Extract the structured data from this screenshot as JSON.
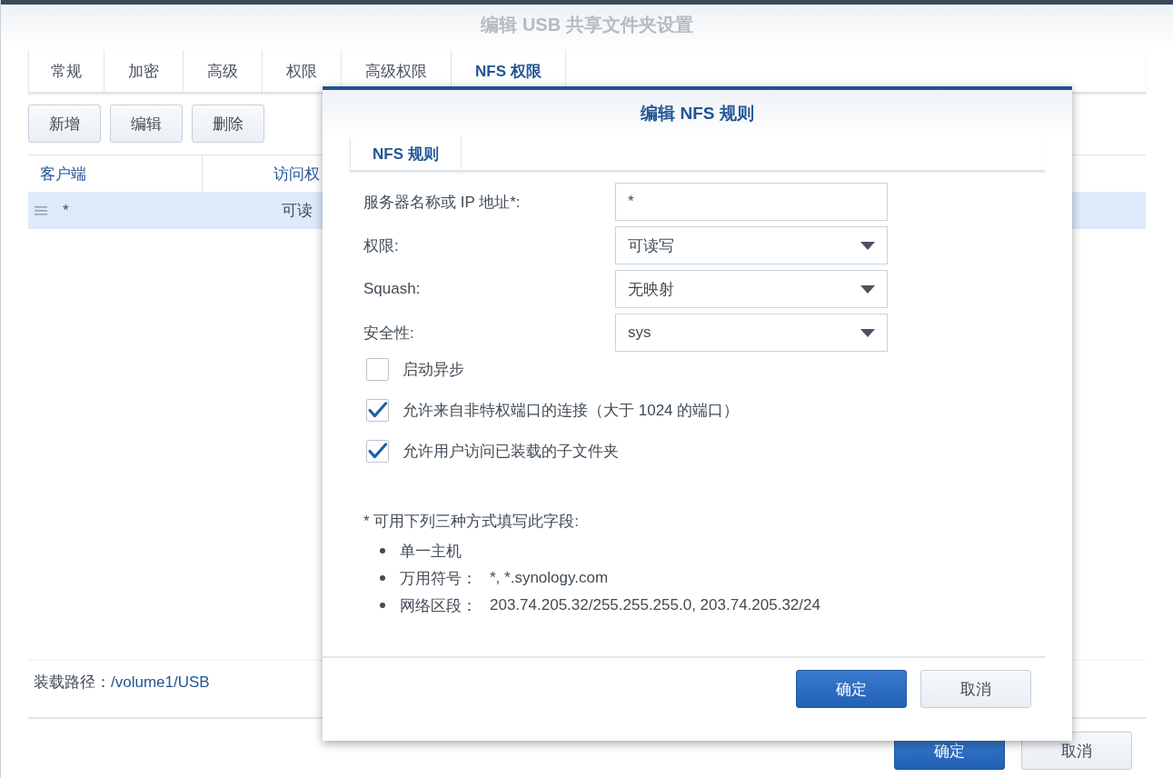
{
  "window": {
    "title": "编辑 USB 共享文件夹设置"
  },
  "tabs": [
    {
      "label": "常规",
      "selected": false
    },
    {
      "label": "加密",
      "selected": false
    },
    {
      "label": "高级",
      "selected": false
    },
    {
      "label": "权限",
      "selected": false
    },
    {
      "label": "高级权限",
      "selected": false
    },
    {
      "label": "NFS 权限",
      "selected": true
    }
  ],
  "toolbar": {
    "buttons": [
      "新增",
      "编辑",
      "删除"
    ]
  },
  "table": {
    "columns": [
      "客户端",
      "访问权"
    ],
    "rows": [
      {
        "cells": [
          "*",
          "可读"
        ],
        "selected": true
      }
    ]
  },
  "mount_path": {
    "label": "装载路径：",
    "value": "/volume1/USB"
  },
  "buttons": [
    {
      "label": "确定",
      "kind": "primary"
    },
    {
      "label": "取消",
      "kind": "secondary"
    }
  ],
  "dialog": {
    "title": "编辑 NFS 规则",
    "tabs": [
      {
        "label": "NFS 规则",
        "selected": true
      }
    ],
    "fields": [
      {
        "label": "服务器名称或 IP 地址*:",
        "kind": "text",
        "value": "*"
      },
      {
        "label": "权限:",
        "kind": "select",
        "value": "可读写"
      },
      {
        "label": "Squash:",
        "kind": "select",
        "value": "无映射"
      },
      {
        "label": "安全性:",
        "kind": "select",
        "value": "sys"
      }
    ],
    "checkboxes": [
      {
        "label": "启动异步",
        "checked": false
      },
      {
        "label": "允许来自非特权端口的连接（大于 1024 的端口）",
        "checked": true
      },
      {
        "label": "允许用户访问已装载的子文件夹",
        "checked": true
      }
    ],
    "note": "* 可用下列三种方式填写此字段:",
    "bullets": [
      {
        "label": "单一主机"
      },
      {
        "label": "万用符号：",
        "value": "*, *.synology.com"
      },
      {
        "label": "网络区段：",
        "value": "203.74.205.32/255.255.255.0, 203.74.205.32/24"
      }
    ],
    "buttons": [
      {
        "label": "确定",
        "kind": "primary"
      },
      {
        "label": "取消",
        "kind": "secondary"
      }
    ]
  }
}
